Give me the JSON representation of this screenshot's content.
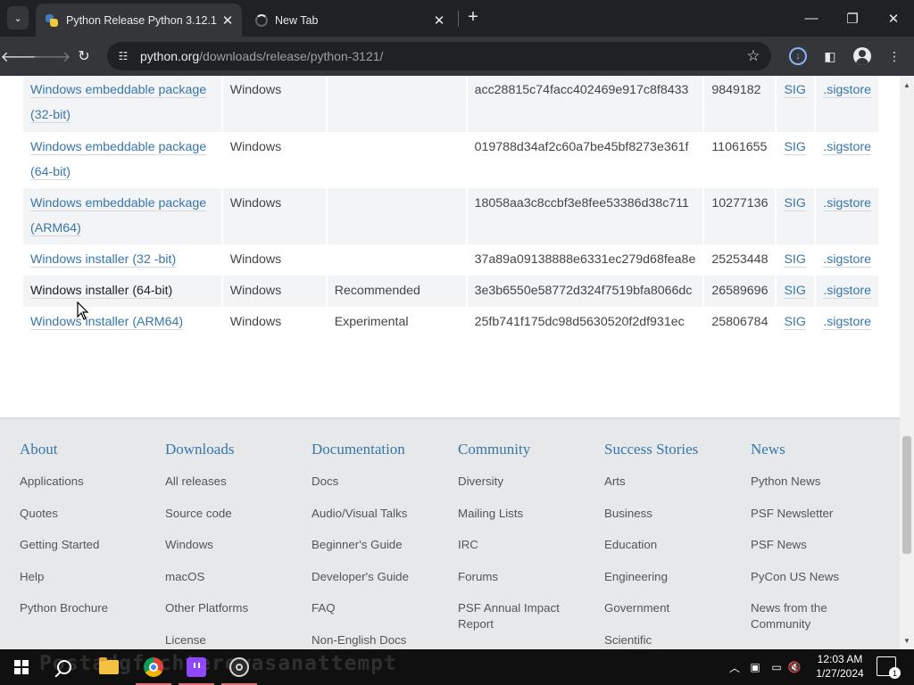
{
  "browser": {
    "tabs": [
      {
        "title": "Python Release Python 3.12.1 | P",
        "close": "✕",
        "active": true
      },
      {
        "title": "New Tab",
        "close": "✕",
        "active": false
      }
    ],
    "new_tab": "+",
    "window_controls": {
      "minimize": "—",
      "maximize": "❐",
      "close": "✕"
    },
    "url": {
      "host": "python.org",
      "path": "/downloads/release/python-3121/"
    }
  },
  "files": {
    "rows": [
      {
        "name_line1": "Windows embeddable package",
        "name_line2": "(32-bit)",
        "os": "Windows",
        "description": "",
        "md5": "acc28815c74facc402469e917c8f8433",
        "size": "9849182",
        "sig": "SIG",
        "sigstore": ".sigstore"
      },
      {
        "name_line1": "Windows embeddable package",
        "name_line2": "(64-bit)",
        "os": "Windows",
        "description": "",
        "md5": "019788d34af2c60a7be45bf8273e361f",
        "size": "11061655",
        "sig": "SIG",
        "sigstore": ".sigstore"
      },
      {
        "name_line1": "Windows embeddable package",
        "name_line2": "(ARM64)",
        "os": "Windows",
        "description": "",
        "md5": "18058aa3c8ccbf3e8fee53386d38c711",
        "size": "10277136",
        "sig": "SIG",
        "sigstore": ".sigstore"
      },
      {
        "name_line1": "Windows installer (32 -bit)",
        "name_line2": "",
        "os": "Windows",
        "description": "",
        "md5": "37a89a09138888e6331ec279d68fea8e",
        "size": "25253448",
        "sig": "SIG",
        "sigstore": ".sigstore"
      },
      {
        "name_line1": "Windows installer (64-bit)",
        "name_line2": "",
        "os": "Windows",
        "description": "Recommended",
        "md5": "3e3b6550e58772d324f7519bfa8066dc",
        "size": "26589696",
        "sig": "SIG",
        "sigstore": ".sigstore"
      },
      {
        "name_line1": "Windows installer (ARM64)",
        "name_line2": "",
        "os": "Windows",
        "description": "Experimental",
        "md5": "25fb741f175dc98d5630520f2df931ec",
        "size": "25806784",
        "sig": "SIG",
        "sigstore": ".sigstore"
      }
    ]
  },
  "footer": {
    "columns": [
      {
        "heading": "About",
        "links": [
          "Applications",
          "Quotes",
          "Getting Started",
          "Help",
          "Python Brochure"
        ]
      },
      {
        "heading": "Downloads",
        "links": [
          "All releases",
          "Source code",
          "Windows",
          "macOS",
          "Other Platforms",
          "License"
        ]
      },
      {
        "heading": "Documentation",
        "links": [
          "Docs",
          "Audio/Visual Talks",
          "Beginner's Guide",
          "Developer's Guide",
          "FAQ",
          "Non-English Docs"
        ]
      },
      {
        "heading": "Community",
        "links": [
          "Diversity",
          "Mailing Lists",
          "IRC",
          "Forums",
          "PSF Annual Impact Report"
        ]
      },
      {
        "heading": "Success Stories",
        "links": [
          "Arts",
          "Business",
          "Education",
          "Engineering",
          "Government",
          "Scientific"
        ]
      },
      {
        "heading": "News",
        "links": [
          "Python News",
          "PSF Newsletter",
          "PSF News",
          "PyCon US News",
          "News from the Community"
        ]
      }
    ]
  },
  "taskbar": {
    "overlay_text": "Postadgfachterewasanattempt",
    "time": "12:03 AM",
    "date": "1/27/2024",
    "notification_count": "1"
  },
  "colors": {
    "link": "#3776ab",
    "footer_bg": "#e6e8ea",
    "chrome_dark": "#202124",
    "chrome_toolbar": "#35363a"
  }
}
